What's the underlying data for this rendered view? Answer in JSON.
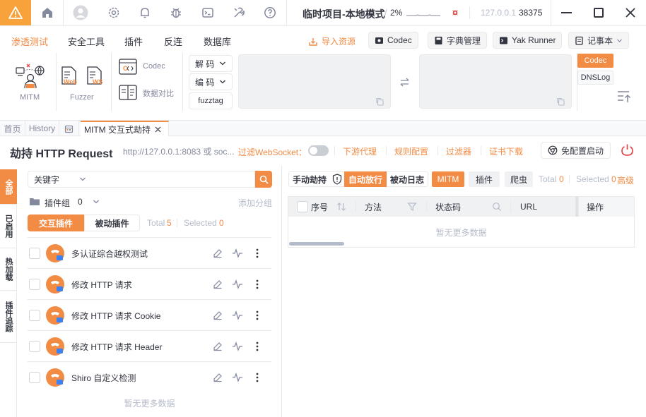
{
  "titlebar": {
    "project": "临时项目-本地模式",
    "separator": "/",
    "cpu": "2%",
    "host": "127.0.0.1",
    "port": "38375"
  },
  "menu": {
    "items": [
      "渗透测试",
      "安全工具",
      "插件",
      "反连",
      "数据库"
    ],
    "import_label": "导入资源",
    "codec_label": "Codec",
    "dict_label": "字典管理",
    "runner_label": "Yak Runner",
    "notes_label": "记事本"
  },
  "tools": {
    "mitm": "MITM",
    "fuzzer": "Fuzzer",
    "fuzzer_web": "Web",
    "fuzzer_ws": "WS",
    "codec": "Codec",
    "compare": "数据对比",
    "decode": "解 码",
    "encode": "编 码",
    "fuzztag": "fuzztag",
    "side_codec": "Codec",
    "side_dnslog": "DNSLog"
  },
  "tabs": {
    "home": "首页",
    "history": "History",
    "mitm": "MITM 交互式劫持"
  },
  "header": {
    "title": "劫持 HTTP Request",
    "url": "http://127.0.0.1:8083 或 soc...",
    "filter_ws": "过滤WebSocket：",
    "links": [
      "下游代理",
      "规则配置",
      "过滤器",
      "证书下载"
    ],
    "quick_start": "免配置启动"
  },
  "vtabs": [
    "全部",
    "已启用",
    "热加载",
    "插件追踪"
  ],
  "plugins": {
    "search_mode": "关键字",
    "search_placeholder": "",
    "group_label": "插件组",
    "group_count": "0",
    "add_group": "添加分组",
    "tab_interactive": "交互插件",
    "tab_passive": "被动插件",
    "total_label": "Total",
    "total": "5",
    "selected_label": "Selected",
    "selected": "0",
    "items": [
      {
        "name": "多认证综合越权测试"
      },
      {
        "name": "修改 HTTP 请求"
      },
      {
        "name": "修改 HTTP 请求 Cookie"
      },
      {
        "name": "修改 HTTP 请求 Header"
      },
      {
        "name": "Shiro 自定义检测"
      }
    ],
    "no_more": "暂无更多数据"
  },
  "traffic": {
    "modes": [
      "手动劫持",
      "自动放行",
      "被动日志"
    ],
    "sub_tabs": [
      "MITM",
      "插件",
      "爬虫"
    ],
    "total_label": "Total",
    "total": "0",
    "selected_label": "Selected",
    "selected": "0",
    "advanced": "高级",
    "columns": [
      "序号",
      "方法",
      "状态码",
      "URL",
      "操作"
    ],
    "empty": "暂无更多数据"
  },
  "colors": {
    "accent": "#f28b44",
    "warning": "#f7a23a",
    "danger": "#e5484d"
  }
}
